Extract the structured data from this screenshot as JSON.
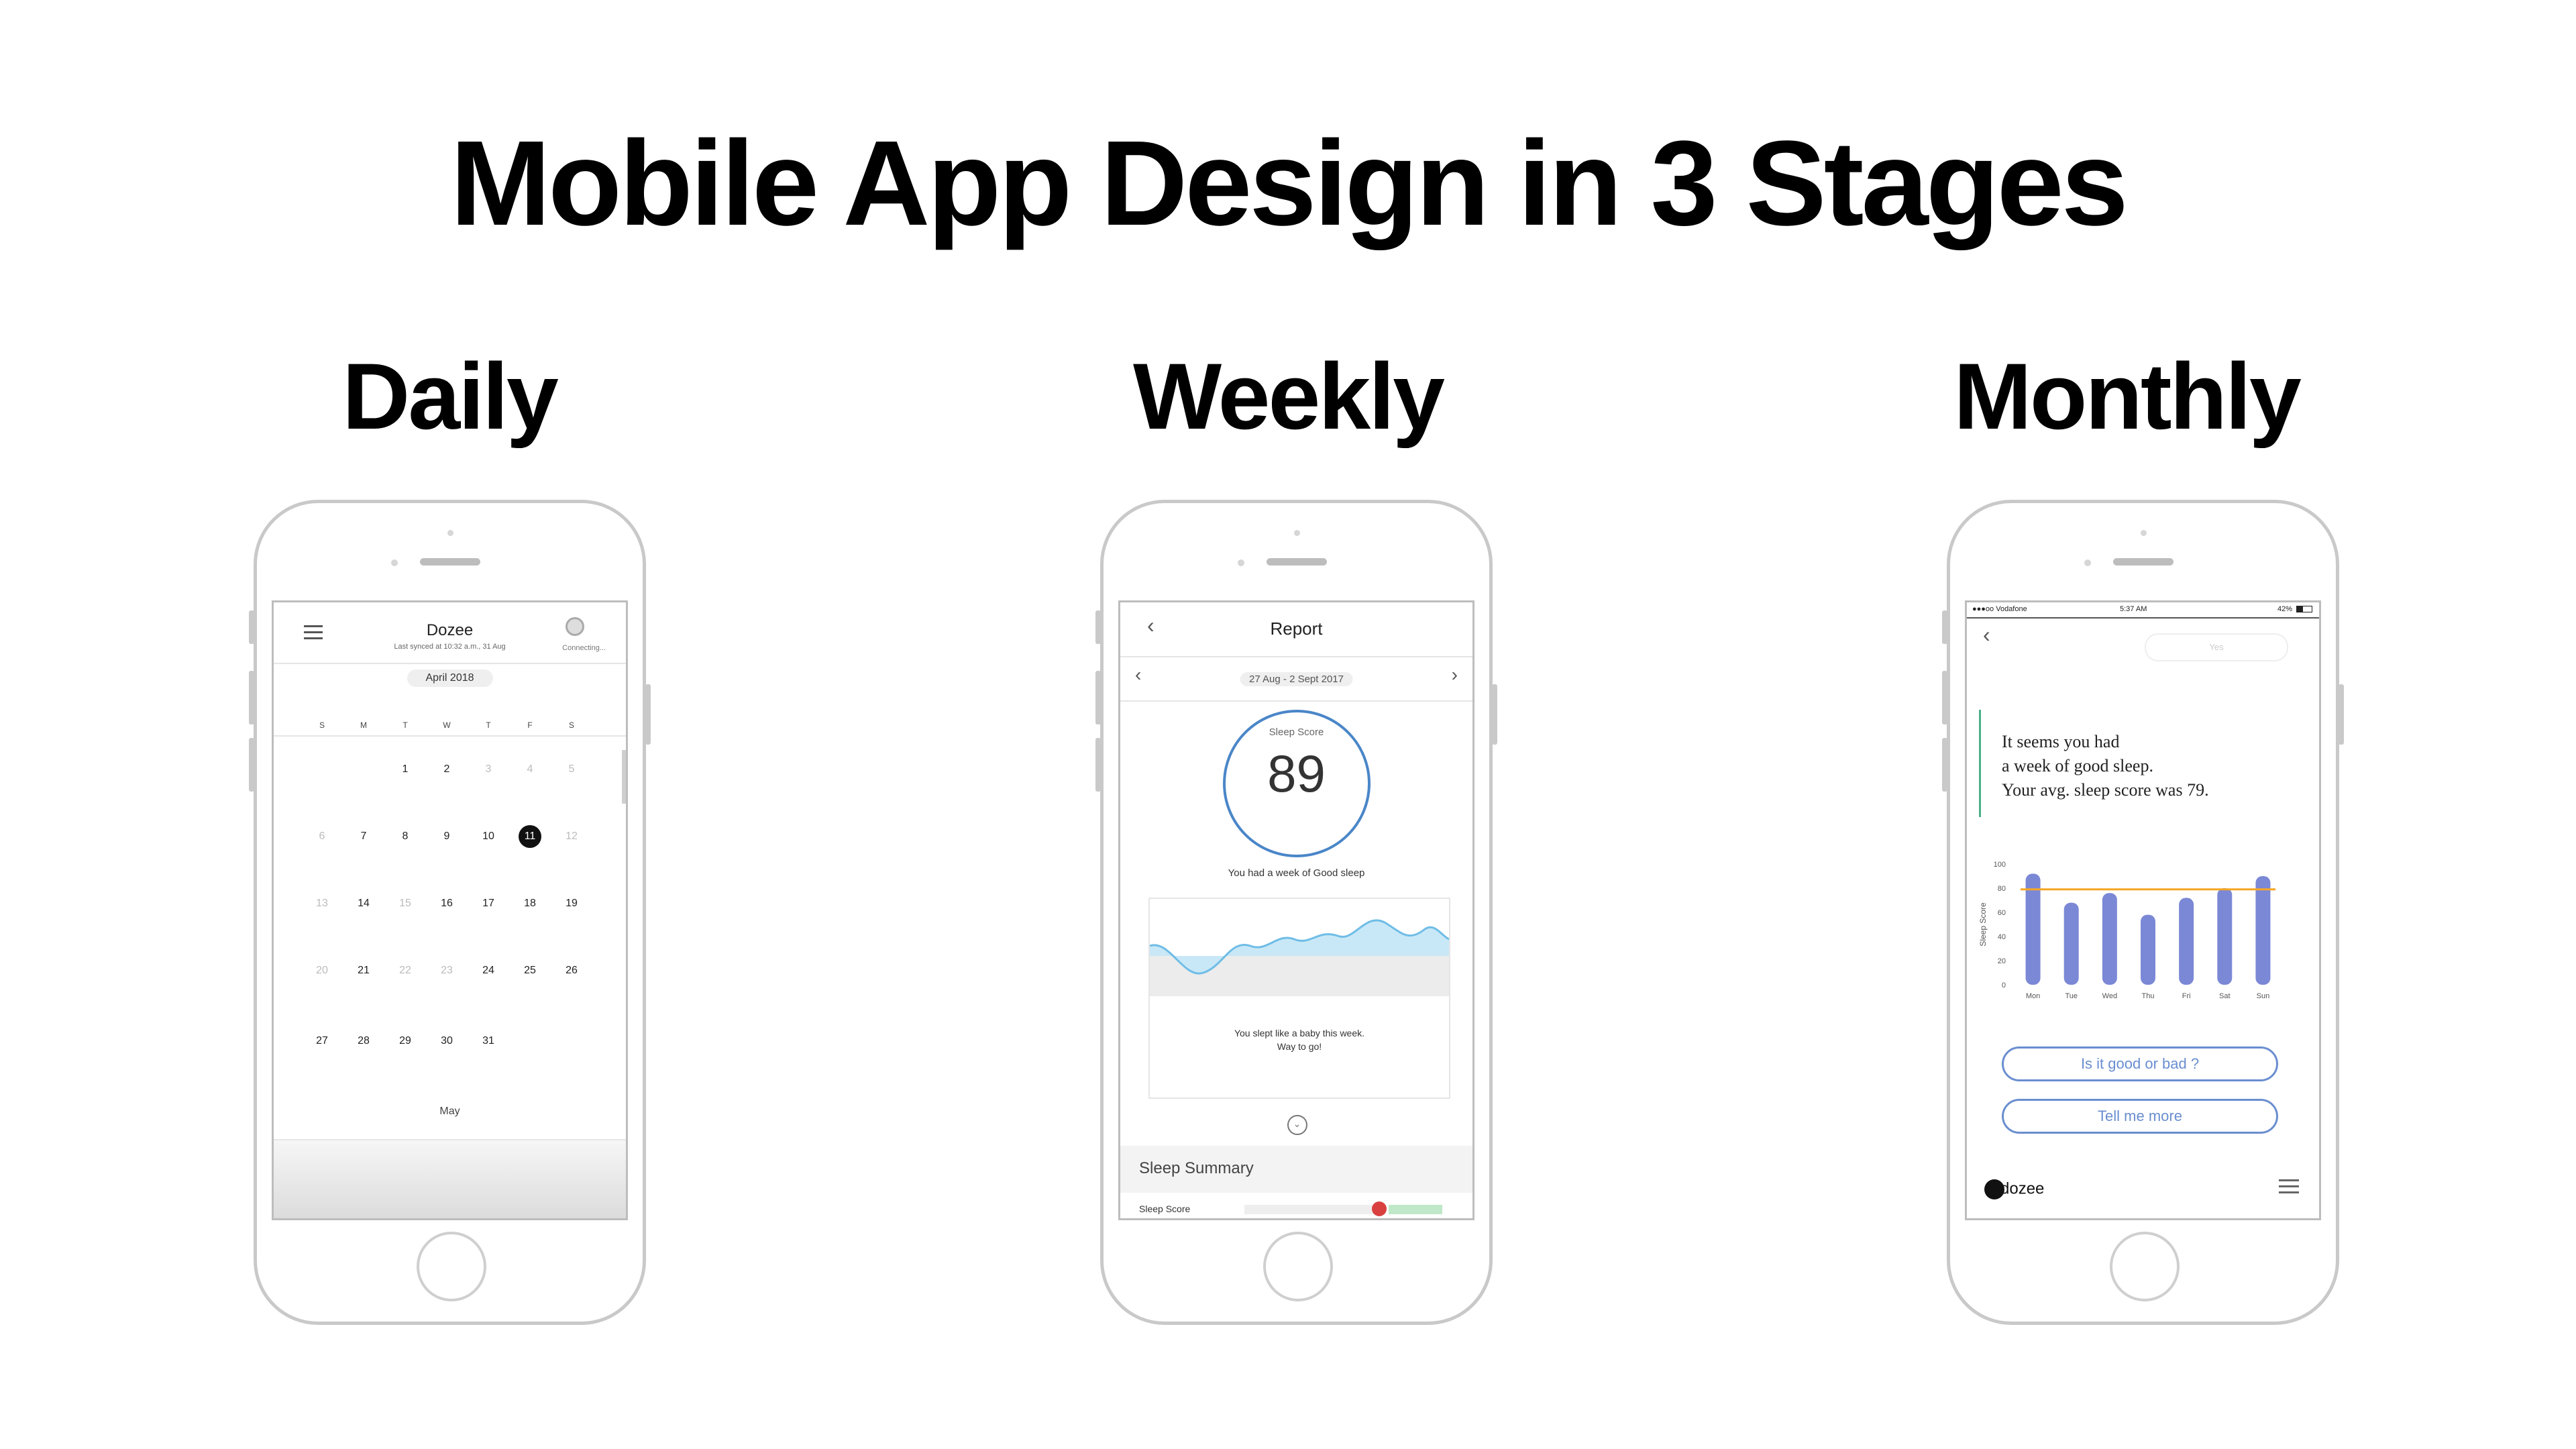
{
  "title": "Mobile App Design in 3 Stages",
  "stages": [
    "Daily",
    "Weekly",
    "Monthly"
  ],
  "daily": {
    "app_name": "Dozee",
    "last_synced": "Last synced at 10:32 a.m., 31 Aug",
    "connection": "Connecting...",
    "month": "April 2018",
    "weekdays": [
      "S",
      "M",
      "T",
      "W",
      "T",
      "F",
      "S"
    ],
    "days": [
      {
        "d": "1",
        "faded": false
      },
      {
        "d": "2",
        "faded": false
      },
      {
        "d": "3",
        "faded": true
      },
      {
        "d": "4",
        "faded": true
      },
      {
        "d": "5",
        "faded": true
      },
      {
        "d": "6",
        "faded": true
      },
      {
        "d": "7",
        "faded": false
      },
      {
        "d": "8",
        "faded": false
      },
      {
        "d": "9",
        "faded": false
      },
      {
        "d": "10",
        "faded": false
      },
      {
        "d": "11",
        "faded": false,
        "selected": true
      },
      {
        "d": "12",
        "faded": true
      },
      {
        "d": "13",
        "faded": true
      },
      {
        "d": "14",
        "faded": false
      },
      {
        "d": "15",
        "faded": true
      },
      {
        "d": "16",
        "faded": false
      },
      {
        "d": "17",
        "faded": false
      },
      {
        "d": "18",
        "faded": false
      },
      {
        "d": "19",
        "faded": false
      },
      {
        "d": "20",
        "faded": true
      },
      {
        "d": "21",
        "faded": false
      },
      {
        "d": "22",
        "faded": true
      },
      {
        "d": "23",
        "faded": true
      },
      {
        "d": "24",
        "faded": false
      },
      {
        "d": "25",
        "faded": false
      },
      {
        "d": "26",
        "faded": false
      },
      {
        "d": "27",
        "faded": false
      },
      {
        "d": "28",
        "faded": false
      },
      {
        "d": "29",
        "faded": false
      },
      {
        "d": "30",
        "faded": false
      },
      {
        "d": "31",
        "faded": false
      }
    ],
    "first_weekday_offset": 2,
    "next_month": "May"
  },
  "weekly": {
    "screen_title": "Report",
    "date_range": "27 Aug - 2 Sept 2017",
    "score_label": "Sleep Score",
    "score_value": "89",
    "score_message": "You had a week of Good sleep",
    "chart_message_line1": "You slept like a baby this week.",
    "chart_message_line2": "Way to go!",
    "summary_title": "Sleep Summary",
    "summary_row": "Sleep Score",
    "ring_color": "#4a86c8",
    "wave_color": "#9fd3f0"
  },
  "monthly": {
    "status_carrier": "●●●oo Vodafone",
    "status_time": "5:37 AM",
    "status_battery": "42%",
    "pill_text": "Yes",
    "message_lines": [
      "It seems you had",
      "a week of good sleep.",
      "Your avg. sleep score was 79."
    ],
    "button_1": "Is it good or bad ?",
    "button_2": "Tell me more",
    "logo": "dozee",
    "accent": "#6a8ed0",
    "bar_color": "#7b88d6",
    "avg_line_color": "#f5a623"
  },
  "chart_data": {
    "type": "bar",
    "categories": [
      "Mon",
      "Tue",
      "Wed",
      "Thu",
      "Fri",
      "Sat",
      "Sun"
    ],
    "values": [
      92,
      68,
      76,
      58,
      72,
      80,
      90
    ],
    "average_line": 79,
    "ylabel": "Sleep Score",
    "yticks": [
      0,
      20,
      40,
      60,
      80,
      100
    ],
    "ylim": [
      0,
      100
    ]
  }
}
